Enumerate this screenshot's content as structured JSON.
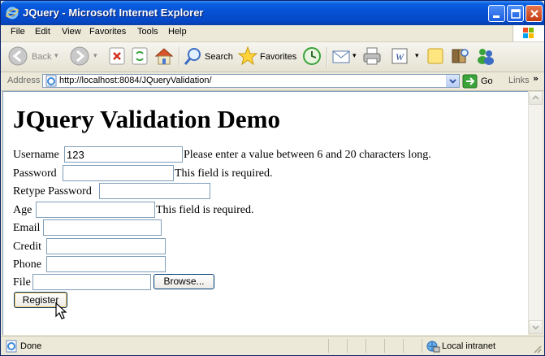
{
  "window": {
    "title": "JQuery - Microsoft Internet Explorer"
  },
  "menu": [
    "File",
    "Edit",
    "View",
    "Favorites",
    "Tools",
    "Help"
  ],
  "toolbar": {
    "back": "Back",
    "search": "Search",
    "favorites": "Favorites"
  },
  "address": {
    "label": "Address",
    "url": "http://localhost:8084/JQueryValidation/",
    "go": "Go",
    "links": "Links"
  },
  "page": {
    "title": "JQuery Validation Demo",
    "username": {
      "label": "Username",
      "value": "123",
      "error": "Please enter a value between 6 and 20 characters long."
    },
    "password": {
      "label": "Password",
      "error": "This field is required."
    },
    "retype": {
      "label": "Retype Password"
    },
    "age": {
      "label": "Age",
      "error": "This field is required."
    },
    "email": {
      "label": "Email"
    },
    "credit": {
      "label": "Credit"
    },
    "phone": {
      "label": "Phone"
    },
    "file": {
      "label": "File",
      "browse": "Browse..."
    },
    "register": "Register"
  },
  "status": {
    "text": "Done",
    "zone": "Local intranet"
  }
}
